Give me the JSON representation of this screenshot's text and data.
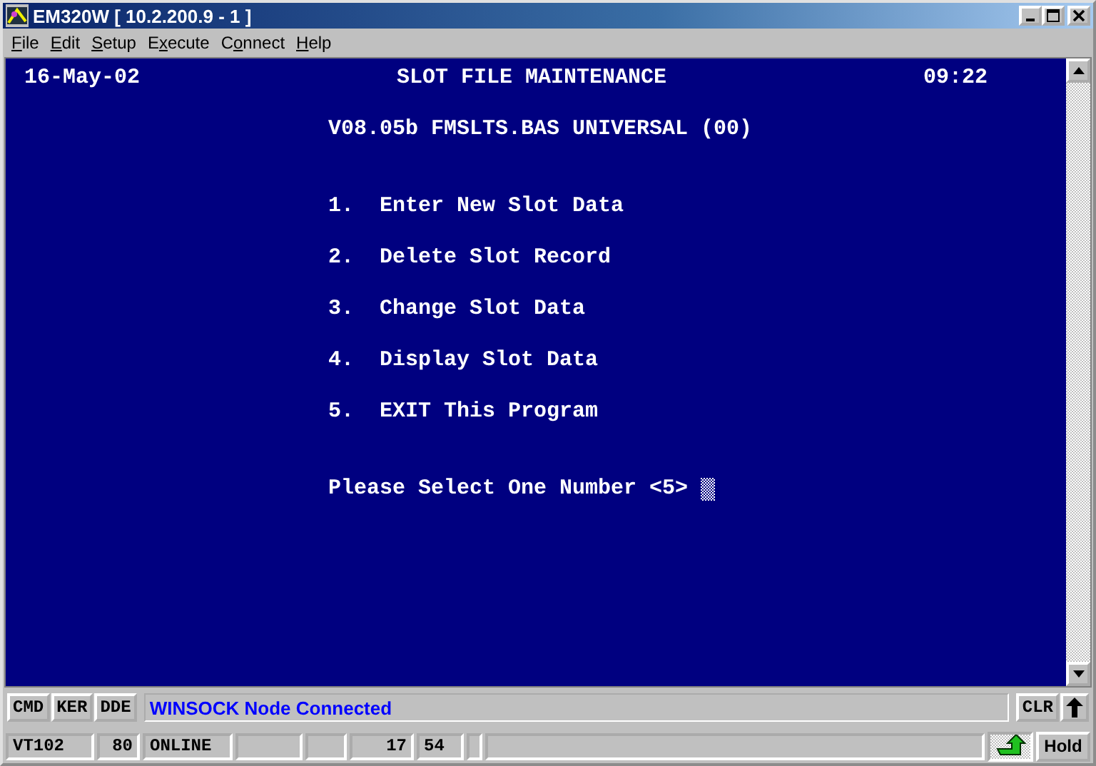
{
  "window": {
    "title": "EM320W [ 10.2.200.9 - 1 ]"
  },
  "menu": [
    {
      "key": "F",
      "rest": "ile"
    },
    {
      "key": "E",
      "rest": "dit"
    },
    {
      "key": "S",
      "rest": "etup"
    },
    {
      "lead": "E",
      "key": "x",
      "rest": "ecute"
    },
    {
      "lead": "C",
      "key": "o",
      "rest": "nnect"
    },
    {
      "key": "H",
      "rest": "elp"
    }
  ],
  "terminal": {
    "date": "16-May-02",
    "title": "SLOT FILE MAINTENANCE",
    "time": "09:22",
    "version": "V08.05b FMSLTS.BAS UNIVERSAL (00)",
    "options": [
      {
        "number": "1.",
        "label": "Enter New Slot Data"
      },
      {
        "number": "2.",
        "label": "Delete Slot Record"
      },
      {
        "number": "3.",
        "label": "Change Slot Data"
      },
      {
        "number": "4.",
        "label": "Display Slot Data"
      },
      {
        "number": "5.",
        "label": "EXIT This Program"
      }
    ],
    "prompt": "Please Select One Number <5>"
  },
  "toolbar": {
    "buttons": [
      "CMD",
      "KER",
      "DDE"
    ],
    "message": "WINSOCK Node Connected",
    "right_buttons": [
      {
        "kind": "text",
        "label": "CLR"
      },
      {
        "kind": "arrow"
      }
    ]
  },
  "status_bar": {
    "cells": [
      {
        "text": "VT102"
      },
      {
        "text": "80"
      },
      {
        "text": "ONLINE"
      },
      {
        "kind": "empty"
      },
      {
        "kind": "empty"
      },
      {
        "text": "17"
      },
      {
        "text": "54"
      },
      {
        "kind": "empty"
      },
      {
        "kind": "empty"
      }
    ],
    "hold": "Hold"
  }
}
